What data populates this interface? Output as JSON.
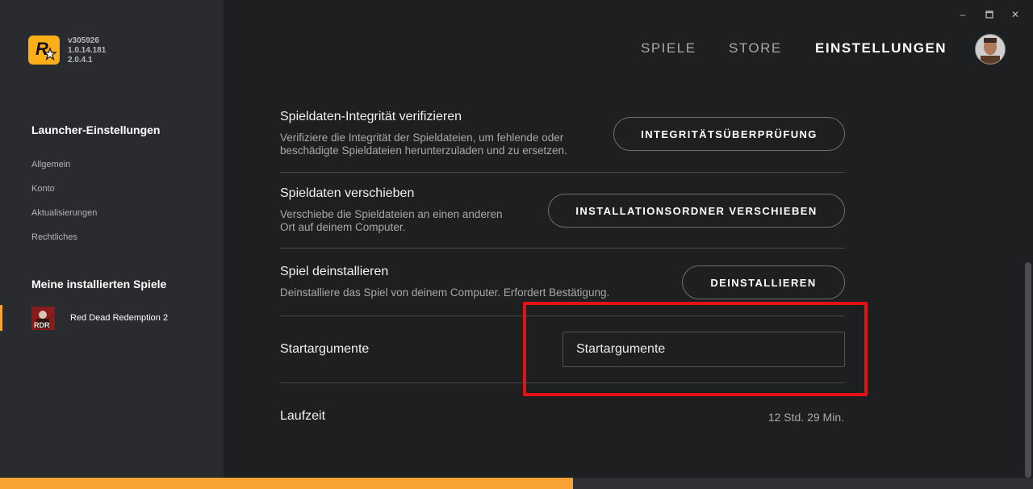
{
  "app": {
    "logo_icon": "rockstar-logo-icon",
    "version_lines": [
      "v305926",
      "1.0.14.181",
      "2.0.4.1"
    ],
    "brand_color": "#fcaf17"
  },
  "window_controls": {
    "minimize": "–",
    "maximize": "▫",
    "close": "✕"
  },
  "nav": {
    "items": [
      {
        "label": "SPIELE",
        "active": false
      },
      {
        "label": "STORE",
        "active": false
      },
      {
        "label": "EINSTELLUNGEN",
        "active": true
      }
    ],
    "avatar_icon": "user-avatar"
  },
  "sidebar": {
    "launcher_heading": "Launcher-Einstellungen",
    "items": [
      {
        "label": "Allgemein"
      },
      {
        "label": "Konto"
      },
      {
        "label": "Aktualisierungen"
      },
      {
        "label": "Rechtliches"
      }
    ],
    "games_heading": "Meine installierten Spiele",
    "games": [
      {
        "label": "Red Dead Redemption 2",
        "selected": true
      }
    ],
    "accent_color": "#f7a233"
  },
  "settings": {
    "verify": {
      "title": "Spieldaten-Integrität verifizieren",
      "desc_line1": "Verifiziere die Integrität der Spieldateien, um fehlende oder",
      "desc_line2": "beschädigte Spieldateien herunterzuladen und zu ersetzen.",
      "button": "INTEGRITÄTSÜBERPRÜFUNG"
    },
    "move": {
      "title": "Spieldaten verschieben",
      "desc_line1": "Verschiebe die Spieldateien an einen anderen",
      "desc_line2": "Ort auf deinem Computer.",
      "button": "INSTALLATIONSORDNER VERSCHIEBEN"
    },
    "uninstall": {
      "title": "Spiel deinstallieren",
      "desc": "Deinstalliere das Spiel von deinem Computer. Erfordert Bestätigung.",
      "button": "DEINSTALLIEREN"
    },
    "launch_args": {
      "title": "Startargumente",
      "input_value": "Startargumente",
      "highlight_color": "#e41118"
    },
    "runtime": {
      "title": "Laufzeit",
      "value": "12 Std. 29 Min."
    }
  },
  "download_progress": 0.555
}
